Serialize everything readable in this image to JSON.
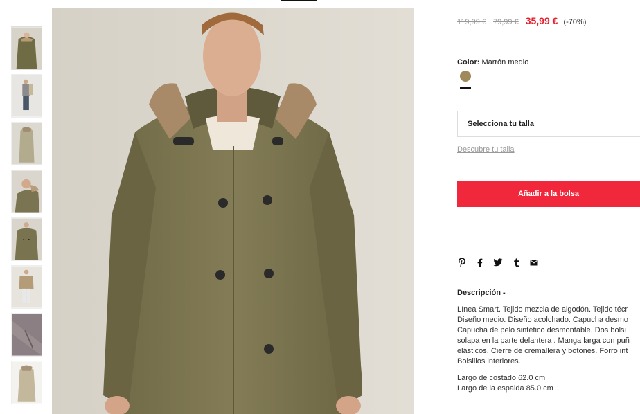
{
  "product": {
    "prices": {
      "original_1": "119,99 €",
      "original_2": "79,99 €",
      "current": "35,99 €",
      "discount": "(-70%)"
    },
    "color": {
      "label": "Color:",
      "value": "Marrón medio",
      "swatch_hex": "#a08a5c"
    },
    "size_select": {
      "label": "Selecciona tu talla"
    },
    "size_guide_link": "Descubre tu talla",
    "add_to_bag_label": "Añadir a la bolsa",
    "share_icons": [
      "pinterest-icon",
      "facebook-icon",
      "twitter-icon",
      "tumblr-icon",
      "email-icon"
    ],
    "description": {
      "title": "Descripción -",
      "lines": [
        "Línea Smart. Tejido mezcla de algodón. Tejido técr",
        "Diseño medio. Diseño acolchado. Capucha desmo",
        "Capucha de pelo sintético desmontable. Dos bolsi",
        "solapa en la parte delantera . Manga larga con puñ",
        "elásticos. Cierre de cremallera y botones. Forro int",
        "Bolsillos interiores."
      ],
      "measures": [
        "Largo de costado 62.0 cm",
        "Largo de la espalda 85.0 cm"
      ]
    }
  },
  "colors": {
    "accent": "#f1273b",
    "price_red": "#e42330",
    "coat": "#7d7650"
  }
}
